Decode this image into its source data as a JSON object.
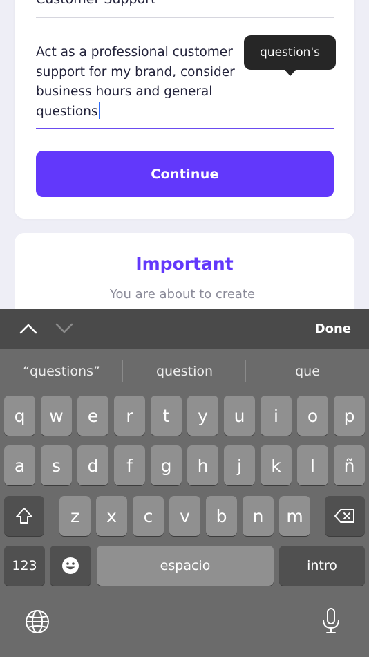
{
  "form": {
    "previous_field_value": "Customer Support",
    "prompt_value": "Act as a professional customer support for my brand, consider business hours and general questions",
    "autocorrect_tooltip": "question's",
    "continue_label": "Continue"
  },
  "important_card": {
    "title": "Important",
    "subtitle": "You are about to create"
  },
  "keyboard": {
    "done_label": "Done",
    "suggestions": [
      "“questions”",
      "question",
      "que"
    ],
    "row1": [
      "q",
      "w",
      "e",
      "r",
      "t",
      "y",
      "u",
      "i",
      "o",
      "p"
    ],
    "row2": [
      "a",
      "s",
      "d",
      "f",
      "g",
      "h",
      "j",
      "k",
      "l",
      "ñ"
    ],
    "row3": [
      "z",
      "x",
      "c",
      "v",
      "b",
      "n",
      "m"
    ],
    "numbers_label": "123",
    "space_label": "espacio",
    "return_label": "intro"
  },
  "colors": {
    "accent": "#6238fb",
    "keyboard_bg": "#6b6b6b",
    "key_bg": "#909090",
    "tooltip_bg": "#262626"
  }
}
